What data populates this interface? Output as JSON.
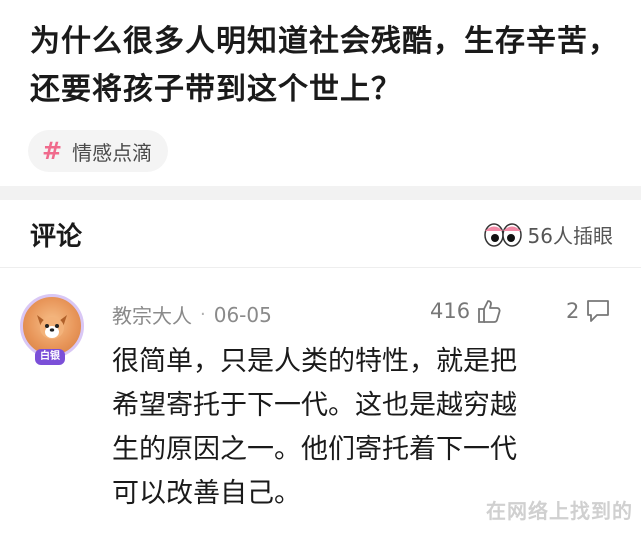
{
  "question": {
    "title": "为什么很多人明知道社会残酷，生存辛苦，还要将孩子带到这个世上？",
    "topic_tag": "情感点滴",
    "topic_hash": "#"
  },
  "comments_section": {
    "title": "评论",
    "reactions_text": "56人插眼"
  },
  "comment": {
    "avatar_badge": "白银",
    "author": "教宗大人",
    "separator": "·",
    "date": "06-05",
    "likes": "416",
    "replies": "2",
    "body": "很简单，只是人类的特性，就是把希望寄托于下一代。这也是越穷越生的原因之一。他们寄托着下一代可以改善自己。"
  },
  "watermark": "在网络上找到的",
  "colors": {
    "tag_hash": "#f06a8c",
    "badge": "#7b4fd8",
    "meta_gray": "#8a8a8a"
  }
}
